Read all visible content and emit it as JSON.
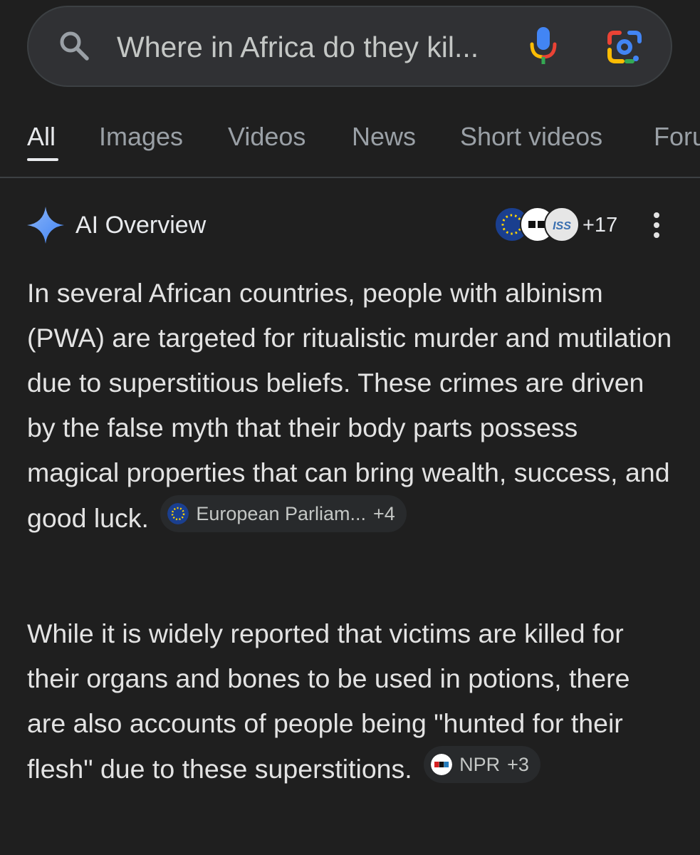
{
  "search": {
    "query": "Where in Africa do they kil..."
  },
  "tabs": [
    {
      "label": "All",
      "active": true
    },
    {
      "label": "Images"
    },
    {
      "label": "Videos"
    },
    {
      "label": "News"
    },
    {
      "label": "Short videos"
    },
    {
      "label": "Foru"
    }
  ],
  "ai_overview": {
    "title": "AI Overview",
    "source_avatar_text": "ISS",
    "sources_more": "+17",
    "paragraph1": "In several African countries, people with albinism (PWA) are targeted for ritualistic murder and mutilation due to superstitious beliefs. These crimes are driven by the false myth that their body parts possess magical properties that can bring wealth, success, and good luck.",
    "chip1": {
      "source": "European Parliam...",
      "more": "+4"
    },
    "paragraph2": "While it is widely reported that victims are killed for their organs and bones to be used in potions, there are also accounts of people being \"hunted for their flesh\" due to these superstitions.",
    "chip2": {
      "source": "NPR",
      "more": "+3"
    }
  },
  "icons": {
    "search": "search-icon",
    "mic": "microphone-icon",
    "lens": "google-lens-icon",
    "sparkle": "ai-sparkle-icon",
    "more": "more-vert-icon"
  },
  "colors": {
    "background": "#1f1f1f",
    "searchbar": "#303134",
    "sparkle": "#4285f4",
    "chip_bg": "#282a2c"
  }
}
